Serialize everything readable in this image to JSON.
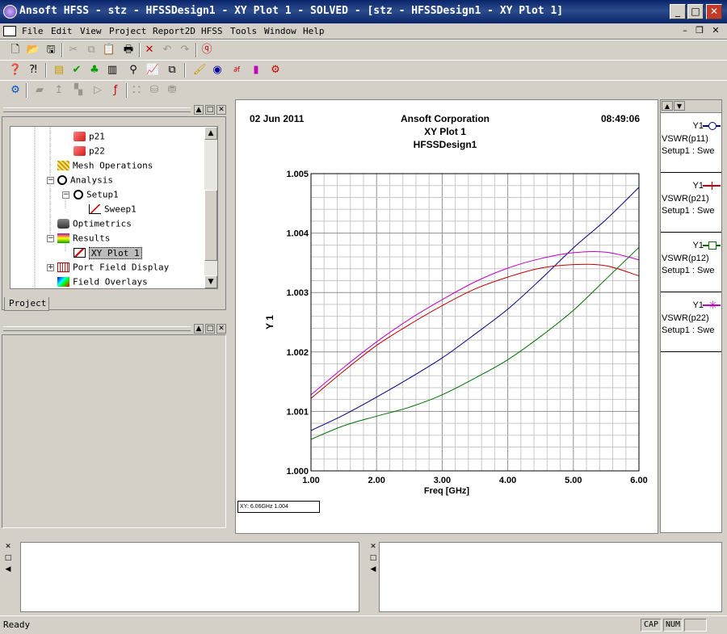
{
  "window": {
    "title": "Ansoft HFSS - stz - HFSSDesign1 - XY Plot 1 - SOLVED - [stz - HFSSDesign1 - XY Plot 1]",
    "minimize": "_",
    "maximize": "□",
    "close": "✕"
  },
  "menu": {
    "items": [
      "File",
      "Edit",
      "View",
      "Project",
      "Report2D",
      "HFSS",
      "Tools",
      "Window",
      "Help"
    ],
    "mdi_minimize": "–",
    "mdi_restore": "❐",
    "mdi_close": "✕"
  },
  "project_tree": {
    "items": [
      {
        "label": "p21",
        "icon": "s-param-icon",
        "color": "#d01a1a"
      },
      {
        "label": "p22",
        "icon": "s-param-icon",
        "color": "#d01a1a"
      },
      {
        "label": "Mesh Operations",
        "icon": "mesh-icon",
        "color": "#c89b00"
      },
      {
        "label": "Analysis",
        "icon": "analysis-icon",
        "color": "#000000"
      },
      {
        "label": "Setup1",
        "icon": "setup-icon",
        "color": "#000000"
      },
      {
        "label": "Sweep1",
        "icon": "sweep-icon",
        "color": "#d01a1a"
      },
      {
        "label": "Optimetrics",
        "icon": "optimetrics-icon",
        "color": "#3b3b3b"
      },
      {
        "label": "Results",
        "icon": "results-icon",
        "color": "#00a000"
      },
      {
        "label": "XY Plot 1",
        "icon": "xy-plot-icon",
        "color": "#d01a1a"
      },
      {
        "label": "Port Field Display",
        "icon": "port-field-icon",
        "color": "#d01a1a"
      },
      {
        "label": "Field Overlays",
        "icon": "field-overlays-icon",
        "color": "#0000ff"
      }
    ],
    "tab_label": "Project"
  },
  "plot": {
    "date": "02 Jun 2011",
    "company": "Ansoft Corporation",
    "title": "XY Plot 1",
    "design": "HFSSDesign1",
    "time": "08:49:06",
    "readout": "XY: 6.06GHz 1.004"
  },
  "legend": [
    {
      "y": "Y1",
      "name": "VSWR(p11)",
      "setup": "Setup1 : Swe",
      "color": "#000080",
      "marker": "circle"
    },
    {
      "y": "Y1",
      "name": "VSWR(p21)",
      "setup": "Setup1 : Swe",
      "color": "#c00000",
      "marker": "plus"
    },
    {
      "y": "Y1",
      "name": "VSWR(p12)",
      "setup": "Setup1 : Swe",
      "color": "#007000",
      "marker": "square"
    },
    {
      "y": "Y1",
      "name": "VSWR(p22)",
      "setup": "Setup1 : Swe",
      "color": "#c000c0",
      "marker": "star"
    }
  ],
  "chart_data": {
    "type": "line",
    "title": "XY Plot 1",
    "xlabel": "Freq [GHz]",
    "ylabel": "Y 1",
    "xlim": [
      1.0,
      6.0
    ],
    "ylim": [
      1.0,
      1.005
    ],
    "xticks": [
      "1.00",
      "2.00",
      "3.00",
      "4.00",
      "5.00",
      "6.00"
    ],
    "yticks": [
      "1.000",
      "1.001",
      "1.002",
      "1.003",
      "1.004",
      "1.005"
    ],
    "grid": true,
    "x": [
      1.0,
      1.5,
      2.0,
      2.5,
      3.0,
      3.5,
      4.0,
      4.5,
      5.0,
      5.5,
      6.0
    ],
    "series": [
      {
        "name": "VSWR(p11)",
        "color": "#000080",
        "values": [
          1.00068,
          1.00094,
          1.00124,
          1.00156,
          1.0019,
          1.0023,
          1.00272,
          1.00322,
          1.00375,
          1.00423,
          1.00477
        ]
      },
      {
        "name": "VSWR(p21)",
        "color": "#c00000",
        "values": [
          1.00122,
          1.00168,
          1.00211,
          1.00246,
          1.00278,
          1.00306,
          1.00326,
          1.00341,
          1.00347,
          1.00345,
          1.00328
        ]
      },
      {
        "name": "VSWR(p12)",
        "color": "#007000",
        "values": [
          1.00053,
          1.00076,
          1.00092,
          1.00107,
          1.00128,
          1.00156,
          1.00187,
          1.00226,
          1.0027,
          1.00323,
          1.00376
        ]
      },
      {
        "name": "VSWR(p22)",
        "color": "#c000c0",
        "values": [
          1.00128,
          1.00174,
          1.00217,
          1.00255,
          1.00288,
          1.00318,
          1.00341,
          1.00357,
          1.00367,
          1.00368,
          1.00355
        ]
      }
    ]
  },
  "status": {
    "text": "Ready",
    "cap": "CAP",
    "num": "NUM"
  }
}
